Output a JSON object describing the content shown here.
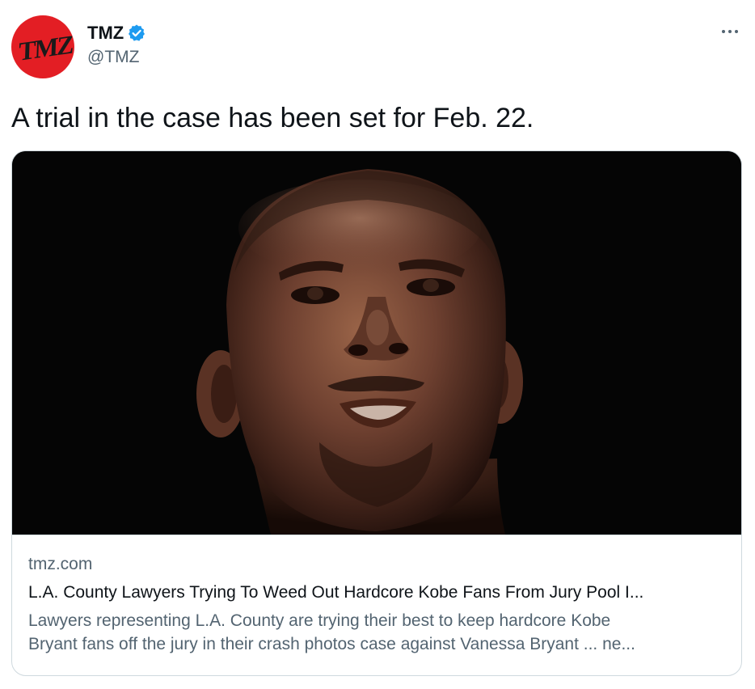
{
  "tweet": {
    "author": {
      "name": "TMZ",
      "handle": "@TMZ",
      "verified": true,
      "avatar_logo_text": "TMZ",
      "avatar_color": "#e31e24"
    },
    "more_icon": "more-horizontal-icon",
    "text": "A trial in the case has been set for Feb. 22.",
    "card": {
      "image_description_icon": "photo-portrait",
      "domain": "tmz.com",
      "title": "L.A. County Lawyers Trying To Weed Out Hardcore Kobe Fans From Jury Pool I...",
      "description_line1": "Lawyers representing L.A. County are trying their best to keep hardcore Kobe",
      "description_line2": "Bryant fans off the jury in their crash photos case against Vanessa Bryant ... ne..."
    }
  },
  "colors": {
    "verified_blue": "#1d9bf0",
    "secondary_text": "#536471",
    "primary_text": "#0f1419",
    "border": "#cfd9de"
  }
}
